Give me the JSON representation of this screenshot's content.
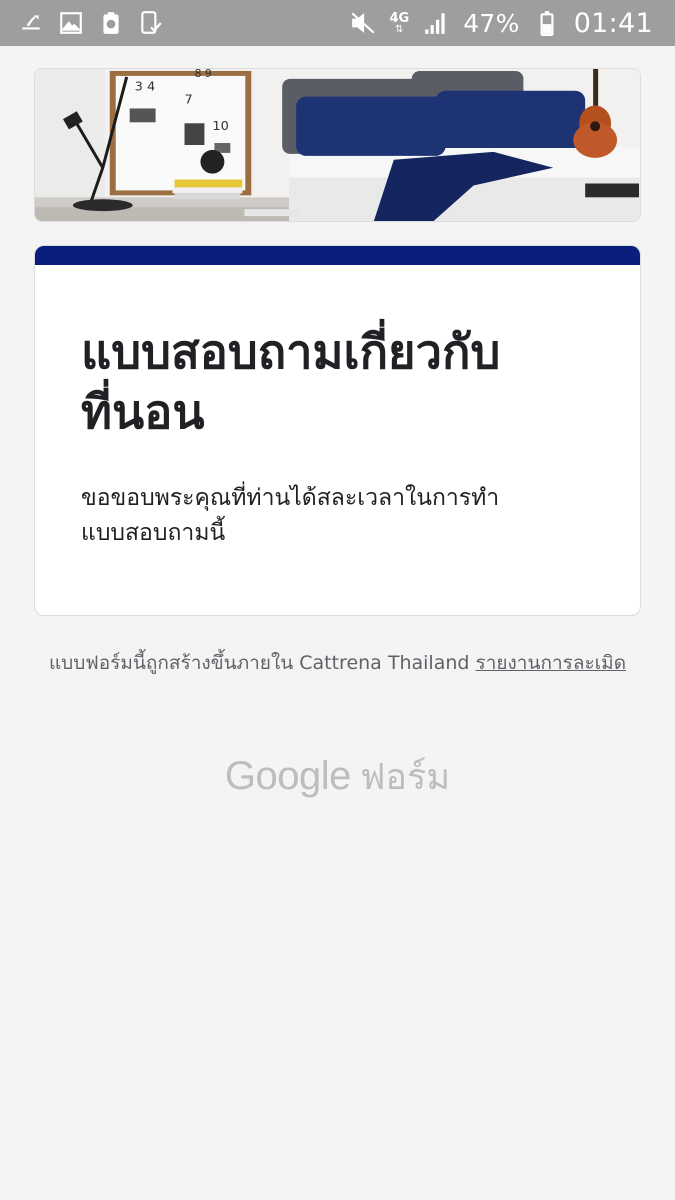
{
  "status_bar": {
    "left_icons": [
      "usb-icon",
      "image-icon",
      "battery-saver-icon",
      "screenshot-icon"
    ],
    "right_icons": [
      "mute-icon",
      "network-icon",
      "signal-icon",
      "battery-icon"
    ],
    "network_type": "4G",
    "battery_percent": "47%",
    "time": "01:41"
  },
  "header": {
    "image_description": "bedroom-mattress-banner"
  },
  "form": {
    "title": "แบบสอบถามเกี่ยวกับที่นอน",
    "description": "ขอขอบพระคุณที่ท่านได้สละเวลาในการทำแบบสอบถามนี้",
    "accent_color": "#0a1e7d"
  },
  "footer": {
    "created_text": "แบบฟอร์มนี้ถูกสร้างขึ้นภายใน Cattrena Thailand",
    "report_link": "รายงานการละเมิด"
  },
  "logo": {
    "google": "Google",
    "forms": "ฟอร์ม"
  }
}
